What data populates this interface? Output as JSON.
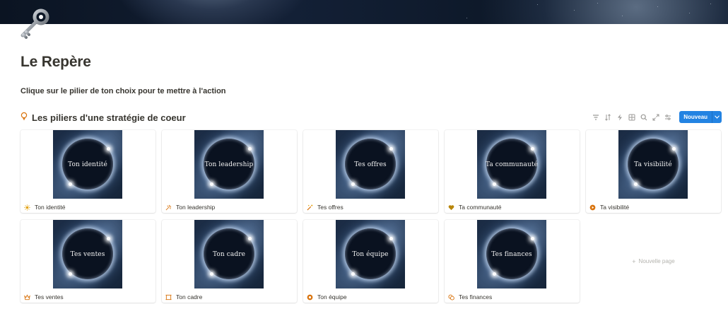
{
  "page": {
    "title": "Le Repère",
    "subtitle": "Clique sur le pilier de ton choix pour te mettre à l'action"
  },
  "database": {
    "title": "Les piliers d'une stratégie de coeur",
    "new_button": "Nouveau",
    "new_page": "Nouvelle page",
    "accent_color": "#2383e2"
  },
  "cards": [
    {
      "image_text": "Ton identité",
      "label": "Ton identité",
      "icon": "sun-icon"
    },
    {
      "image_text": "Ton leadership",
      "label": "Ton leadership",
      "icon": "fireworks-icon"
    },
    {
      "image_text": "Tes offres",
      "label": "Tes offres",
      "icon": "magic-wand-icon"
    },
    {
      "image_text": "Ta communauté",
      "label": "Ta communauté",
      "icon": "heart-icon"
    },
    {
      "image_text": "Ta visibilité",
      "label": "Ta visibilité",
      "icon": "play-circle-icon"
    },
    {
      "image_text": "Tes ventes",
      "label": "Tes ventes",
      "icon": "crown-icon"
    },
    {
      "image_text": "Ton cadre",
      "label": "Ton cadre",
      "icon": "frame-icon"
    },
    {
      "image_text": "Ton équipe",
      "label": "Ton équipe",
      "icon": "gear-icon"
    },
    {
      "image_text": "Tes finances",
      "label": "Tes finances",
      "icon": "coins-icon"
    }
  ]
}
